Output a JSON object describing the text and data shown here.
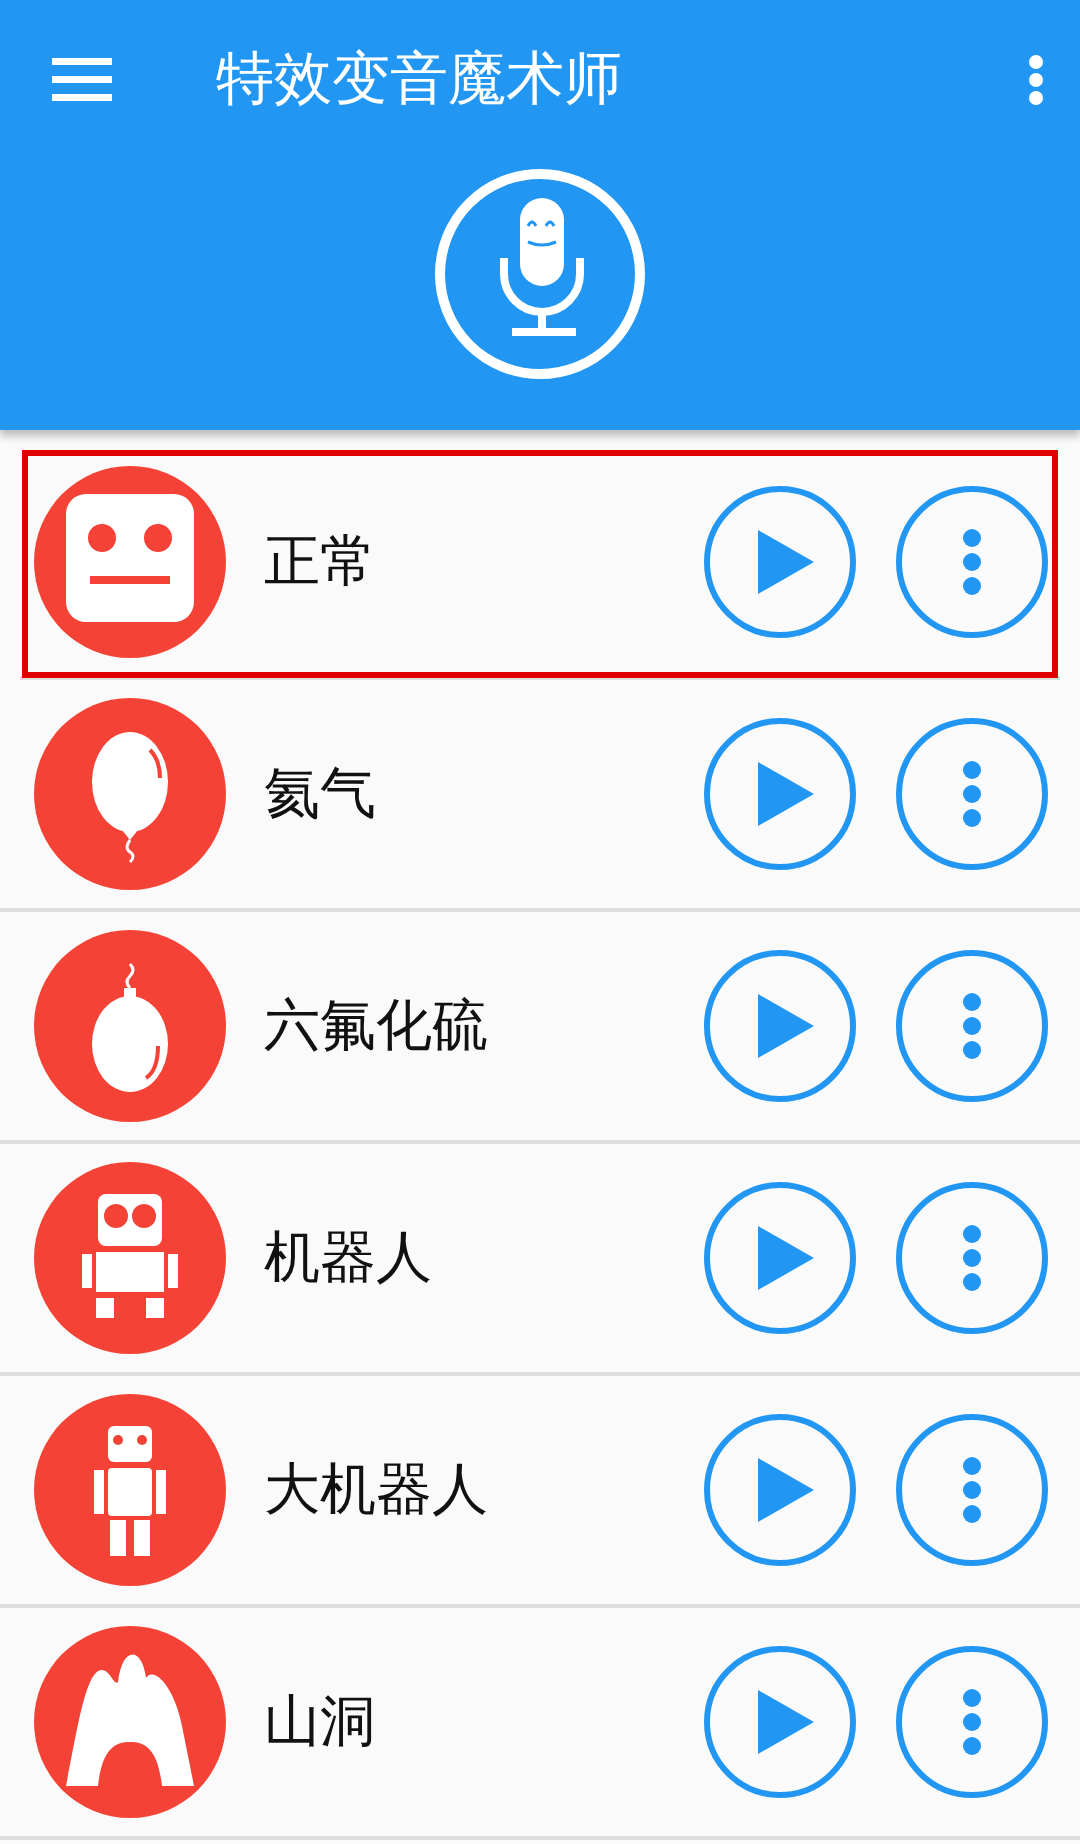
{
  "app_bar": {
    "title": "特效变音魔术师"
  },
  "effects": [
    {
      "label": "正常",
      "kind": "face",
      "selected": true
    },
    {
      "label": "氦气",
      "kind": "balloon",
      "selected": false
    },
    {
      "label": "六氟化硫",
      "kind": "heavy-balloon",
      "selected": false
    },
    {
      "label": "机器人",
      "kind": "robot",
      "selected": false
    },
    {
      "label": "大机器人",
      "kind": "big-robot",
      "selected": false
    },
    {
      "label": "山洞",
      "kind": "cave",
      "selected": false
    }
  ]
}
